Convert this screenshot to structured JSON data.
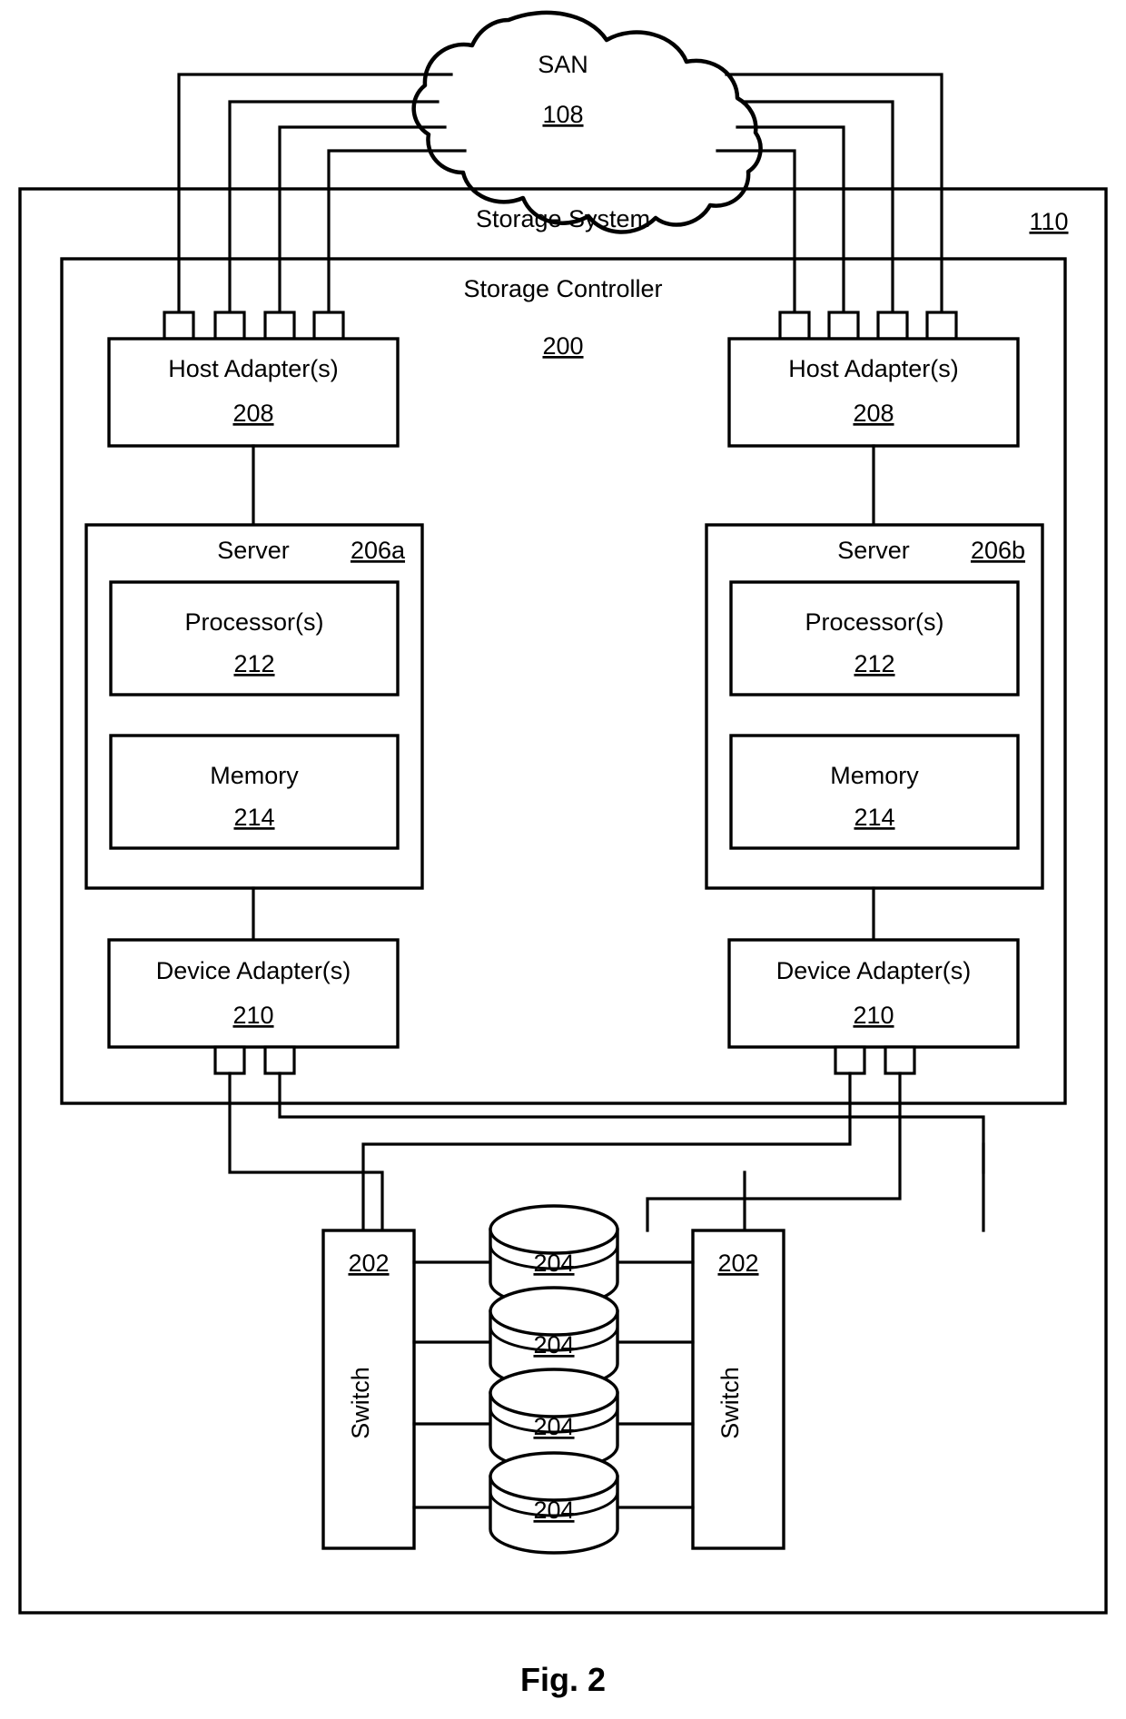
{
  "figure": {
    "caption": "Fig. 2"
  },
  "san": {
    "label": "SAN",
    "ref": "108",
    "icon": "cloud-icon"
  },
  "storage_system": {
    "label": "Storage System",
    "ref": "110"
  },
  "storage_controller": {
    "label": "Storage Controller",
    "ref": "200"
  },
  "nodes": {
    "host_adapter_left": {
      "label": "Host Adapter(s)",
      "ref": "208",
      "ports": 4
    },
    "host_adapter_right": {
      "label": "Host Adapter(s)",
      "ref": "208",
      "ports": 4
    },
    "server_left": {
      "label": "Server",
      "ref": "206a"
    },
    "server_right": {
      "label": "Server",
      "ref": "206b"
    },
    "processor_left": {
      "label": "Processor(s)",
      "ref": "212"
    },
    "processor_right": {
      "label": "Processor(s)",
      "ref": "212"
    },
    "memory_left": {
      "label": "Memory",
      "ref": "214"
    },
    "memory_right": {
      "label": "Memory",
      "ref": "214"
    },
    "device_adapter_left": {
      "label": "Device Adapter(s)",
      "ref": "210",
      "ports": 2
    },
    "device_adapter_right": {
      "label": "Device Adapter(s)",
      "ref": "210",
      "ports": 2
    },
    "switch_left": {
      "label": "Switch",
      "ref": "202"
    },
    "switch_right": {
      "label": "Switch",
      "ref": "202"
    }
  },
  "disks": [
    {
      "ref": "204"
    },
    {
      "ref": "204"
    },
    {
      "ref": "204"
    },
    {
      "ref": "204"
    }
  ],
  "colors": {
    "line": "#000000",
    "fill": "#ffffff",
    "text": "#000000"
  }
}
